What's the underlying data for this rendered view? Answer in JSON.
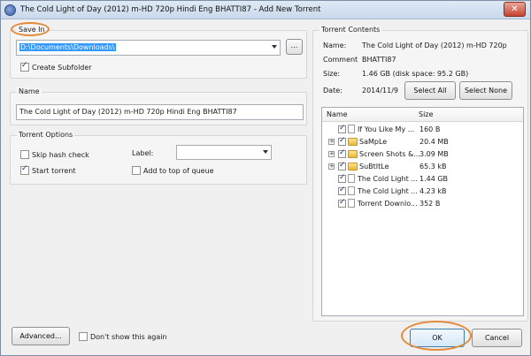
{
  "window": {
    "title": "The Cold Light of Day (2012)  m-HD  720p  Hindi  Eng  BHATTI87 - Add New Torrent",
    "close_glyph": "✕"
  },
  "save_in": {
    "section_label": "Save In",
    "path": "D:\\Documents\\Downloads\\",
    "browse_label": "...",
    "create_subfolder_label": "Create Subfolder",
    "create_subfolder_checked": true
  },
  "name_section": {
    "label": "Name",
    "value": "The Cold Light of Day (2012)  m-HD  720p  Hindi  Eng  BHATTI87"
  },
  "options": {
    "label": "Torrent Options",
    "skip_hash_label": "Skip hash check",
    "skip_hash_checked": false,
    "start_torrent_label": "Start torrent",
    "start_torrent_checked": true,
    "label_field_label": "Label:",
    "label_value": "",
    "add_top_label": "Add to top of queue",
    "add_top_checked": false
  },
  "contents": {
    "label": "Torrent Contents",
    "name_key": "Name:",
    "name_value": "The Cold Light of Day (2012)  m-HD  720p",
    "comment_key": "Comment",
    "comment_value": "BHATTI87",
    "size_key": "Size:",
    "size_value": "1.46 GB (disk space: 95.2 GB)",
    "date_key": "Date:",
    "date_value": "2014/11/9",
    "select_all_label": "Select All",
    "select_none_label": "Select None"
  },
  "file_tree": {
    "columns": {
      "name": "Name",
      "size": "Size"
    },
    "rows": [
      {
        "name": "If You Like My ...",
        "size": "160 B",
        "kind": "file",
        "expandable": false
      },
      {
        "name": "SaMpLe",
        "size": "20.4 MB",
        "kind": "folder",
        "expandable": true
      },
      {
        "name": "Screen Shots &...",
        "size": "3.09 MB",
        "kind": "folder",
        "expandable": true
      },
      {
        "name": "SuBtItLe",
        "size": "65.3 kB",
        "kind": "folder",
        "expandable": true
      },
      {
        "name": "The Cold Light ...",
        "size": "1.44 GB",
        "kind": "file",
        "expandable": false
      },
      {
        "name": "The Cold Light ...",
        "size": "4.23 kB",
        "kind": "file",
        "expandable": false
      },
      {
        "name": "Torrent Downlo...",
        "size": "352 B",
        "kind": "file",
        "expandable": false
      }
    ]
  },
  "footer": {
    "advanced_label": "Advanced...",
    "dont_show_label": "Don't show this again",
    "dont_show_checked": false,
    "ok_label": "OK",
    "cancel_label": "Cancel"
  },
  "colors": {
    "annotation_circle": "#e38a3a",
    "selection": "#3399ff"
  }
}
